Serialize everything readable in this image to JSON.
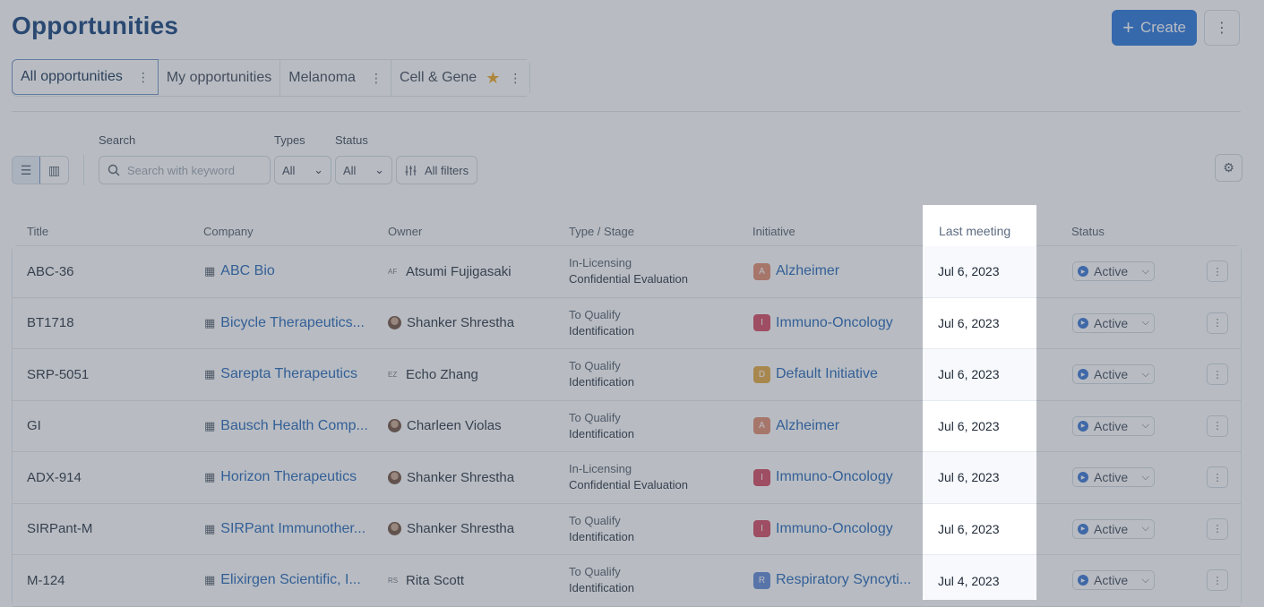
{
  "header": {
    "title": "Opportunities",
    "create_label": "Create",
    "create_icon": "plus-icon",
    "more_icon": "more-vertical-icon"
  },
  "tabs": [
    {
      "label": "All opportunities",
      "active": true,
      "has_menu": true
    },
    {
      "label": "My opportunities",
      "active": false,
      "has_menu": false
    },
    {
      "label": "Melanoma",
      "active": false,
      "has_menu": true
    },
    {
      "label": "Cell & Gene",
      "active": false,
      "has_menu": true,
      "starred": true
    }
  ],
  "filters": {
    "search_label": "Search",
    "search_placeholder": "Search with keyword",
    "types_label": "Types",
    "types_value": "All",
    "status_label": "Status",
    "status_value": "All",
    "all_filters_label": "All filters"
  },
  "columns": {
    "title": "Title",
    "company": "Company",
    "owner": "Owner",
    "type_stage": "Type / Stage",
    "initiative": "Initiative",
    "last_meeting": "Last meeting",
    "status": "Status"
  },
  "rows": [
    {
      "title": "ABC-36",
      "company": "ABC Bio",
      "owner": "Atsumi Fujigasaki",
      "owner_initials": "AF",
      "owner_has_photo": false,
      "type": "In-Licensing",
      "stage": "Confidential Evaluation",
      "initiative": "Alzheimer",
      "initiative_letter": "A",
      "initiative_color": "#e2876a",
      "last_meeting": "Jul 6, 2023",
      "status": "Active"
    },
    {
      "title": "BT1718",
      "company": "Bicycle Therapeutics...",
      "owner": "Shanker Shrestha",
      "owner_initials": "",
      "owner_has_photo": true,
      "type": "To Qualify",
      "stage": "Identification",
      "initiative": "Immuno-Oncology",
      "initiative_letter": "I",
      "initiative_color": "#d2405a",
      "last_meeting": "Jul 6, 2023",
      "status": "Active"
    },
    {
      "title": "SRP-5051",
      "company": "Sarepta Therapeutics",
      "owner": "Echo Zhang",
      "owner_initials": "EZ",
      "owner_has_photo": false,
      "type": "To Qualify",
      "stage": "Identification",
      "initiative": "Default Initiative",
      "initiative_letter": "D",
      "initiative_color": "#e3a437",
      "last_meeting": "Jul 6, 2023",
      "status": "Active"
    },
    {
      "title": "GI",
      "company": "Bausch Health Comp...",
      "owner": "Charleen Violas",
      "owner_initials": "",
      "owner_has_photo": true,
      "type": "To Qualify",
      "stage": "Identification",
      "initiative": "Alzheimer",
      "initiative_letter": "A",
      "initiative_color": "#e2876a",
      "last_meeting": "Jul 6, 2023",
      "status": "Active"
    },
    {
      "title": "ADX-914",
      "company": "Horizon Therapeutics",
      "owner": "Shanker Shrestha",
      "owner_initials": "",
      "owner_has_photo": true,
      "type": "In-Licensing",
      "stage": "Confidential Evaluation",
      "initiative": "Immuno-Oncology",
      "initiative_letter": "I",
      "initiative_color": "#d2405a",
      "last_meeting": "Jul 6, 2023",
      "status": "Active"
    },
    {
      "title": "SIRPant-M",
      "company": "SIRPant Immunother...",
      "owner": "Shanker Shrestha",
      "owner_initials": "",
      "owner_has_photo": true,
      "type": "To Qualify",
      "stage": "Identification",
      "initiative": "Immuno-Oncology",
      "initiative_letter": "I",
      "initiative_color": "#d2405a",
      "last_meeting": "Jul 6, 2023",
      "status": "Active"
    },
    {
      "title": "M-124",
      "company": "Elixirgen Scientific, I...",
      "owner": "Rita Scott",
      "owner_initials": "RS",
      "owner_has_photo": false,
      "type": "To Qualify",
      "stage": "Identification",
      "initiative": "Respiratory Syncyti...",
      "initiative_letter": "R",
      "initiative_color": "#5a86d6",
      "last_meeting": "Jul 4, 2023",
      "status": "Active"
    }
  ]
}
